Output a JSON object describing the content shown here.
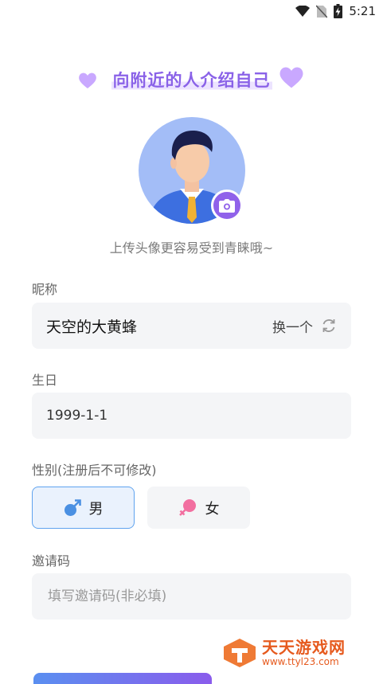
{
  "status_bar": {
    "time": "5:21",
    "icons": [
      "wifi-icon",
      "no-sim-icon",
      "battery-charging-icon"
    ]
  },
  "header": {
    "title": "向附近的人介绍自己",
    "decorations": [
      "heart-icon",
      "heart-icon"
    ]
  },
  "avatar": {
    "hint": "上传头像更容易受到青睐哦~",
    "camera_icon": "camera-icon"
  },
  "nickname": {
    "label": "昵称",
    "value": "天空的大黄蜂",
    "change_label": "换一个",
    "change_icon": "refresh-icon"
  },
  "birthday": {
    "label": "生日",
    "value": "1999-1-1"
  },
  "gender": {
    "label": "性别(注册后不可修改)",
    "options": [
      {
        "label": "男",
        "icon": "male-icon",
        "selected": true
      },
      {
        "label": "女",
        "icon": "female-icon",
        "selected": false
      }
    ]
  },
  "invite": {
    "label": "邀请码",
    "placeholder": "填写邀请码(非必填)",
    "value": ""
  },
  "watermark": {
    "title": "天天游戏网",
    "url": "www.ttyl23.com"
  },
  "colors": {
    "accent_purple": "#8a62e8",
    "male_blue": "#4a90e2",
    "female_pink": "#f26fa0",
    "field_bg": "#f4f5f7"
  }
}
